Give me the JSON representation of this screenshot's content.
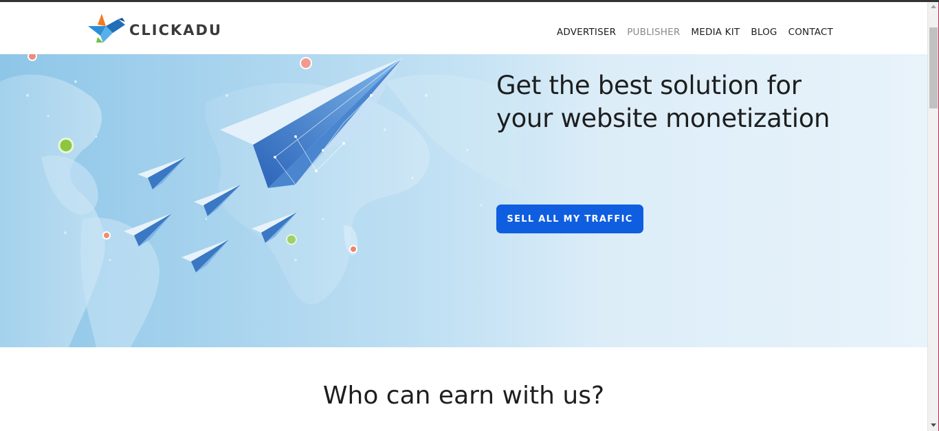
{
  "brand": {
    "name": "CLICKADU",
    "colors": {
      "orange": "#f47b20",
      "blue": "#2b8fd6",
      "green": "#78c043",
      "text": "#3a3a3a"
    }
  },
  "nav": {
    "items": [
      {
        "label": "ADVERTISER",
        "active": false
      },
      {
        "label": "PUBLISHER",
        "active": true
      },
      {
        "label": "MEDIA KIT",
        "active": false
      },
      {
        "label": "BLOG",
        "active": false
      },
      {
        "label": "CONTACT",
        "active": false
      }
    ]
  },
  "hero": {
    "title": "Get the best solution for your website monetization",
    "cta_label": "SELL ALL MY TRAFFIC",
    "illustration": "world-map-paper-planes",
    "accent": "#0f5ee0"
  },
  "section": {
    "title": "Who can earn with us?"
  }
}
